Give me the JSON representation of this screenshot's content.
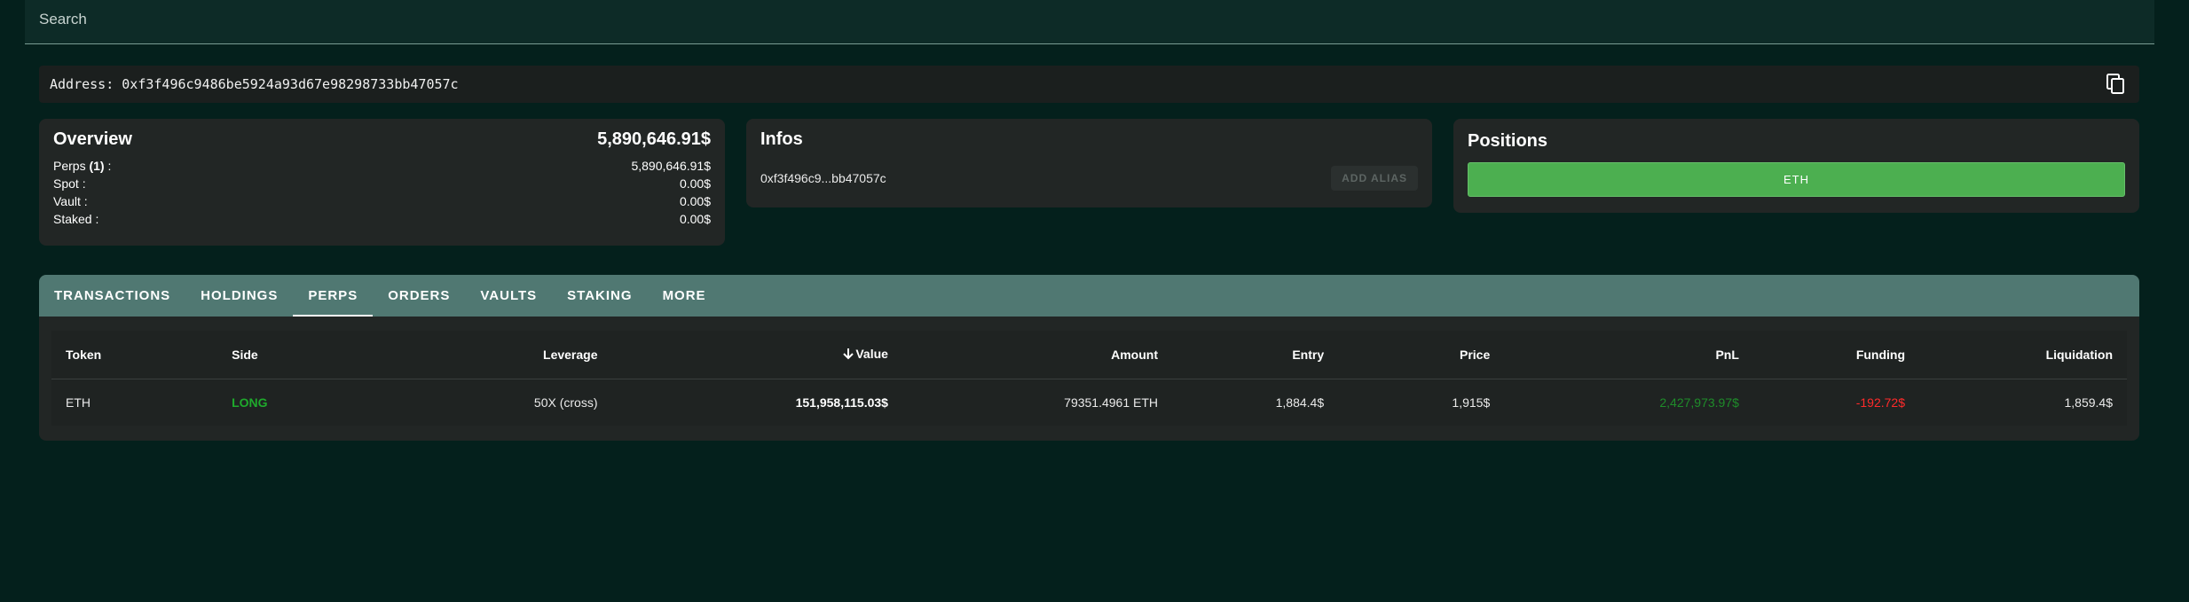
{
  "search": {
    "placeholder": "Search"
  },
  "address": {
    "label": "Address: 0xf3f496c9486be5924a93d67e98298733bb47057c"
  },
  "overview": {
    "title": "Overview",
    "total": "5,890,646.91$",
    "perps_label": "Perps ",
    "perps_count": "(1)",
    "perps_suffix": " :",
    "perps_value": "5,890,646.91$",
    "spot_label": "Spot :",
    "spot_value": "0.00$",
    "vault_label": "Vault :",
    "vault_value": "0.00$",
    "staked_label": "Staked :",
    "staked_value": "0.00$"
  },
  "infos": {
    "title": "Infos",
    "short_address": "0xf3f496c9...bb47057c",
    "add_alias_label": "ADD ALIAS"
  },
  "positions": {
    "title": "Positions",
    "items": [
      {
        "label": "ETH",
        "color": "#4caf50"
      }
    ]
  },
  "tabs": [
    {
      "label": "TRANSACTIONS",
      "active": false
    },
    {
      "label": "HOLDINGS",
      "active": false
    },
    {
      "label": "PERPS",
      "active": true
    },
    {
      "label": "ORDERS",
      "active": false
    },
    {
      "label": "VAULTS",
      "active": false
    },
    {
      "label": "STAKING",
      "active": false
    },
    {
      "label": "MORE",
      "active": false
    }
  ],
  "table": {
    "headers": [
      "Token",
      "Side",
      "Leverage",
      "Value",
      "Amount",
      "Entry",
      "Price",
      "PnL",
      "Funding",
      "Liquidation"
    ],
    "sorted_by": "Value",
    "rows": [
      [
        "ETH",
        "LONG",
        "50X (cross)",
        "151,958,115.03$",
        "79351.4961 ETH",
        "1,884.4$",
        "1,915$",
        "2,427,973.97$",
        "-192.72$",
        "1,859.4$"
      ]
    ]
  },
  "colors": {
    "background": "#04201c",
    "tab_bar": "#507872",
    "long": "#1faa2c",
    "pnl_positive": "#1f8c2a",
    "funding_negative": "#ff2a2a",
    "position_button": "#4caf50"
  }
}
